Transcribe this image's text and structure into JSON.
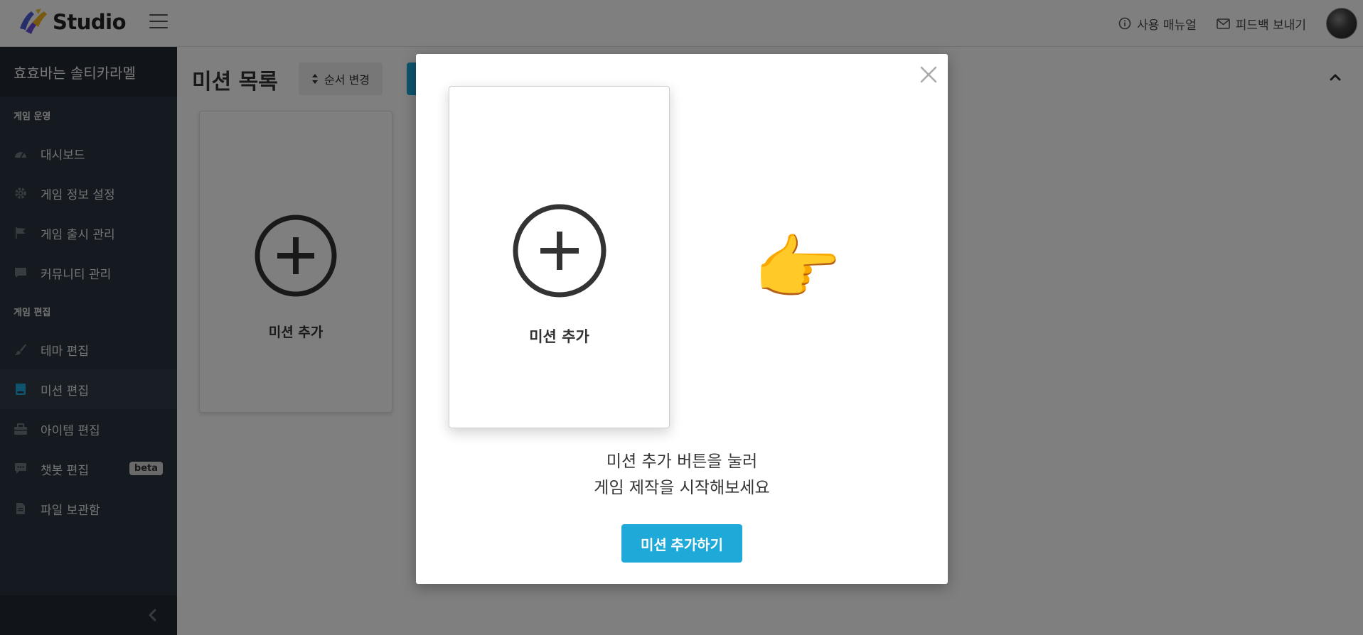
{
  "app": {
    "logo_text": "Studio"
  },
  "header": {
    "manual_label": "사용 매뉴얼",
    "feedback_label": "피드백 보내기"
  },
  "sidebar": {
    "game_title": "효효바는 솔티카라멜",
    "sections": [
      {
        "label": "게임 운영",
        "items": [
          {
            "label": "대시보드",
            "icon": "dashboard-icon"
          },
          {
            "label": "게임 정보 설정",
            "icon": "gear-icon"
          },
          {
            "label": "게임 출시 관리",
            "icon": "flag-icon"
          },
          {
            "label": "커뮤니티 관리",
            "icon": "comment-icon"
          }
        ]
      },
      {
        "label": "게임 편집",
        "items": [
          {
            "label": "테마 편집",
            "icon": "brush-icon"
          },
          {
            "label": "미션 편집",
            "icon": "book-icon",
            "active": true
          },
          {
            "label": "아이템 편집",
            "icon": "toolbox-icon"
          },
          {
            "label": "챗봇 편집",
            "icon": "chat-icon",
            "badge": "beta"
          },
          {
            "label": "파일 보관함",
            "icon": "file-icon"
          }
        ]
      }
    ]
  },
  "main": {
    "title": "미션 목록",
    "order_button_label": "순서 변경",
    "card_label": "미션 추가"
  },
  "modal": {
    "card_label": "미션 추가",
    "hand_emoji": "👉",
    "hint_line1": "미션 추가 버튼을 눌러",
    "hint_line2": "게임 제작을 시작해보세요",
    "primary_button_label": "미션 추가하기"
  },
  "colors": {
    "sidebar_bg": "#2b3440",
    "accent": "#1fa9d9",
    "active_icon": "#1fa9d9"
  }
}
